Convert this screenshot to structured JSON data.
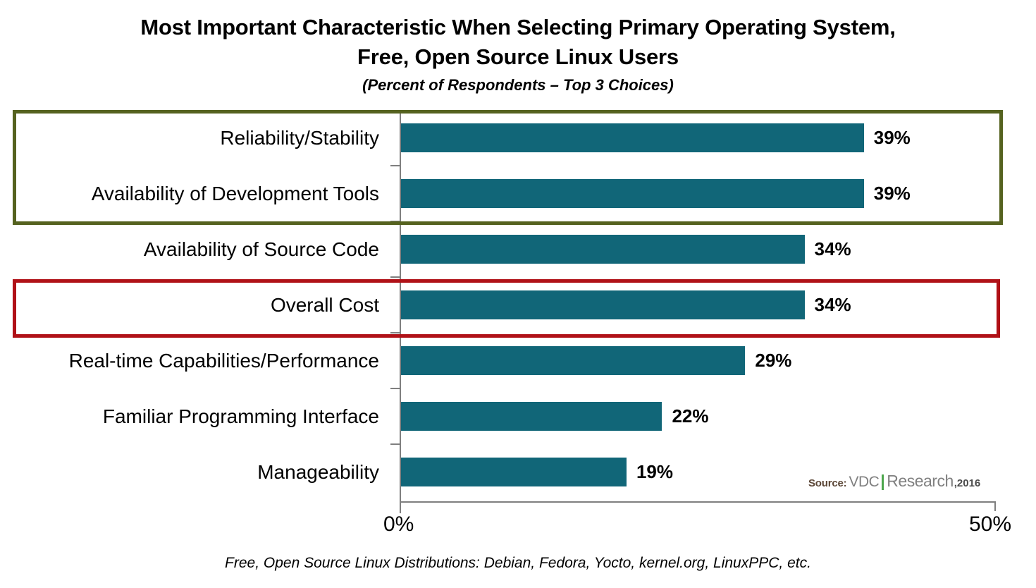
{
  "title": {
    "line1": "Most Important Characteristic When Selecting Primary Operating System,",
    "line2": "Free, Open Source Linux Users",
    "subtitle": "(Percent of Respondents – Top 3 Choices)"
  },
  "footnote": "Free, Open Source Linux Distributions: Debian, Fedora,  Yocto, kernel.org, LinuxPPC, etc.",
  "source": {
    "prefix": "Source:",
    "brand_first": "VDC",
    "brand_second": "Research",
    "year": ",2016",
    "divider_color": "#4ca64c"
  },
  "axis": {
    "min_label": "0%",
    "max_label": "50%"
  },
  "highlights": [
    {
      "name": "olive-highlight",
      "color": "#55621f",
      "covers": [
        "Reliability/Stability",
        "Availability of Development Tools"
      ]
    },
    {
      "name": "red-highlight",
      "color": "#b01117",
      "covers": [
        "Overall Cost"
      ]
    }
  ],
  "chart_data": {
    "type": "bar",
    "orientation": "horizontal",
    "title": "Most Important Characteristic When Selecting Primary Operating System, Free, Open Source Linux Users",
    "subtitle": "(Percent of Respondents – Top 3 Choices)",
    "xlabel": "",
    "ylabel": "",
    "xlim": [
      0,
      50
    ],
    "grid": false,
    "legend": null,
    "bar_color": "#116678",
    "categories": [
      "Reliability/Stability",
      "Availability of Development Tools",
      "Availability of Source Code",
      "Overall Cost",
      "Real-time Capabilities/Performance",
      "Familiar Programming Interface",
      "Manageability"
    ],
    "values": [
      39,
      39,
      34,
      34,
      29,
      22,
      19
    ],
    "value_labels": [
      "39%",
      "39%",
      "34%",
      "34%",
      "29%",
      "22%",
      "19%"
    ],
    "tick_labels": [
      "0%",
      "50%"
    ],
    "annotations": [
      "Source:VDC|Research,2016",
      "Free, Open Source Linux Distributions: Debian, Fedora,  Yocto, kernel.org, LinuxPPC, etc."
    ]
  }
}
